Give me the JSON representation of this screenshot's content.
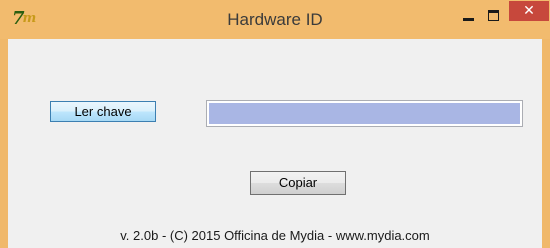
{
  "window": {
    "title": "Hardware ID",
    "icon": "7m-app-icon",
    "icon_text": "7",
    "icon_sub": "m",
    "close_glyph": "✕",
    "colors": {
      "frame": "#f2bb6e",
      "close": "#c7483c",
      "client": "#f0f0f0",
      "selection": "#a9b6e4"
    }
  },
  "main": {
    "read_key_label": "Ler chave",
    "hardware_id_value": "",
    "copy_label": "Copiar",
    "footer_text": "v. 2.0b - (C) 2015 Officina de Mydia - www.mydia.com"
  }
}
